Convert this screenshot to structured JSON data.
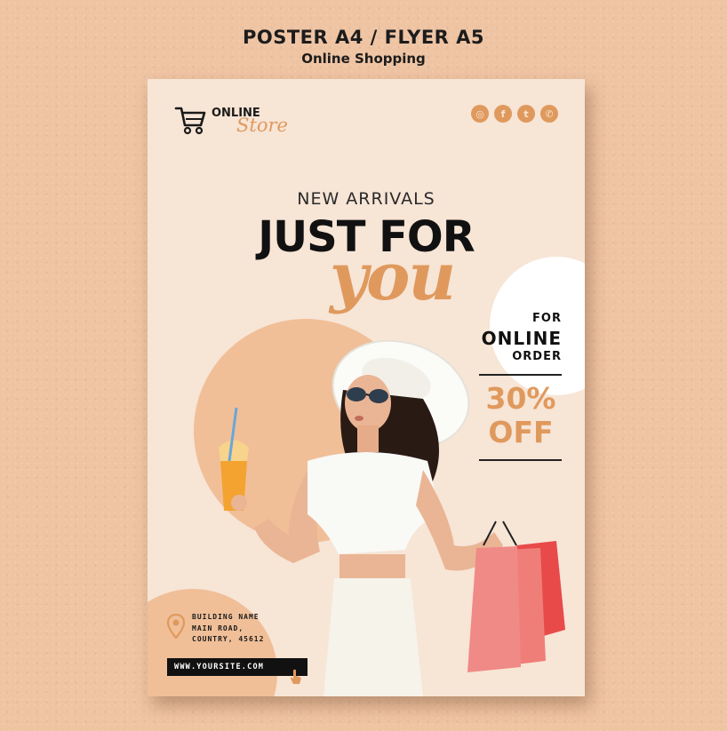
{
  "header": {
    "title": "POSTER A4 / FLYER A5",
    "subtitle": "Online Shopping"
  },
  "poster": {
    "logo": {
      "word1": "ONLINE",
      "word2": "Store"
    },
    "socials": [
      {
        "icon": "instagram-icon",
        "glyph": "◎"
      },
      {
        "icon": "facebook-icon",
        "glyph": "f"
      },
      {
        "icon": "twitter-icon",
        "glyph": "t"
      },
      {
        "icon": "whatsapp-icon",
        "glyph": "✆"
      }
    ],
    "eyebrow": "NEW ARRIVALS",
    "headline": "JUST FOR",
    "script": "you",
    "order": {
      "line1": "FOR",
      "line2": "ONLINE",
      "line3": "ORDER"
    },
    "discount": {
      "percent": "30%",
      "off": "OFF"
    },
    "address": {
      "line1": "BUILDING NAME",
      "line2": "MAIN ROAD,",
      "line3": "COUNTRY, 45612"
    },
    "website": "WWW.YOURSITE.COM"
  },
  "colors": {
    "background": "#efc4a3",
    "poster": "#f7e5d6",
    "accent": "#e0995d",
    "circle": "#f0bf98",
    "text": "#111111"
  }
}
